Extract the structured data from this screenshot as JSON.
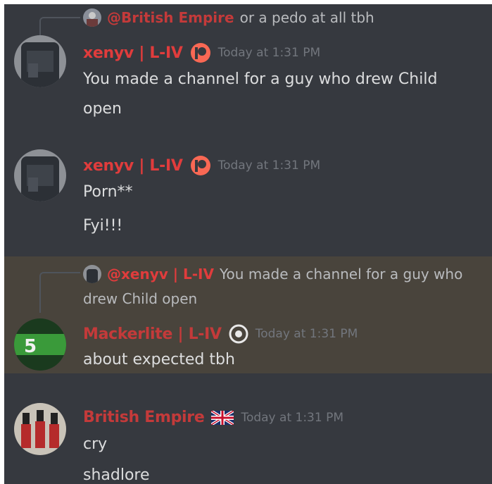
{
  "colors": {
    "background": "#36393f",
    "highlight": "#49443c",
    "name_red": "#e03c3c",
    "name_red_dim": "#c43a3a",
    "timestamp": "#72767d",
    "body_text": "#dcddde",
    "reply_text": "#b9bbbe"
  },
  "messages": [
    {
      "reply": {
        "mention": "@British Empire",
        "text": "or a pedo at all tbh"
      },
      "author": "xenyv | L-IV",
      "badge_icon": "patreon-icon",
      "timestamp": "Today at 1:31 PM",
      "lines": [
        "You made a channel for a guy who drew Child",
        "open"
      ]
    },
    {
      "author": "xenyv | L-IV",
      "badge_icon": "patreon-icon",
      "timestamp": "Today at 1:31 PM",
      "lines": [
        "Porn**",
        "Fyi!!!"
      ]
    },
    {
      "reply": {
        "mention": "@xenyv | L-IV",
        "text": "You made a channel for a guy who",
        "text2": "drew Child open"
      },
      "author": "Mackerlite | L-IV",
      "badge_icon": "scp-logo-icon",
      "timestamp": "Today at 1:31 PM",
      "lines": [
        "about expected tbh"
      ]
    },
    {
      "author": "British Empire",
      "badge_icon": "union-jack-flag-icon",
      "timestamp": "Today at 1:31 PM",
      "lines": [
        "cry",
        "shadlore"
      ]
    }
  ]
}
